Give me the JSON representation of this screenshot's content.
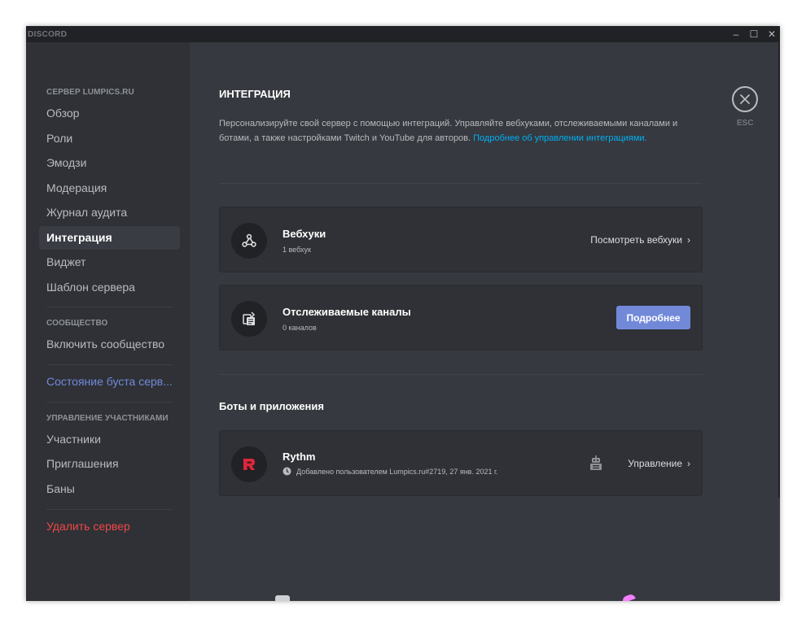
{
  "app": {
    "brand": "DISCORD"
  },
  "window_controls": {
    "minimize": "–",
    "maximize": "☐",
    "close": "✕"
  },
  "sidebar": {
    "group_server": "СЕРВЕР LUMPICS.RU",
    "items_server": [
      {
        "label": "Обзор"
      },
      {
        "label": "Роли"
      },
      {
        "label": "Эмодзи"
      },
      {
        "label": "Модерация"
      },
      {
        "label": "Журнал аудита"
      },
      {
        "label": "Интеграция"
      },
      {
        "label": "Виджет"
      },
      {
        "label": "Шаблон сервера"
      }
    ],
    "group_community": "СООБЩЕСТВО",
    "community_item": "Включить сообщество",
    "boost_item": "Состояние буста серв...",
    "group_members": "УПРАВЛЕНИЕ УЧАСТНИКАМИ",
    "items_members": [
      {
        "label": "Участники"
      },
      {
        "label": "Приглашения"
      },
      {
        "label": "Баны"
      }
    ],
    "delete_item": "Удалить сервер"
  },
  "main": {
    "title": "ИНТЕГРАЦИЯ",
    "description": "Персонализируйте свой сервер с помощью интеграций. Управляйте вебхуками, отслеживаемыми каналами и ботами, а также настройками Twitch и YouTube для авторов. ",
    "description_link": "Подробнее об управлении интеграциями.",
    "webhooks": {
      "title": "Вебхуки",
      "subtitle": "1 вебхук",
      "action": "Посмотреть вебхуки"
    },
    "followed": {
      "title": "Отслеживаемые каналы",
      "subtitle": "0 каналов",
      "button": "Подробнее"
    },
    "bots_section": "Боты и приложения",
    "bot": {
      "name": "Rythm",
      "added": "Добавлено пользователем Lumpics.ru#2719, 27 янв. 2021 г.",
      "action": "Управление"
    },
    "close_label": "ESC"
  },
  "colors": {
    "background": "#36393f",
    "sidebar": "#2f3136",
    "accent": "#7289da",
    "link": "#00aff4",
    "danger": "#f04747",
    "rythm_red": "#e0253b"
  },
  "icons": {
    "webhooks": "webhook-icon",
    "followed": "followed-channel-icon",
    "bot_avatar": "rythm-logo-icon",
    "added_by": "clock-icon",
    "bot_permissions": "robot-icon",
    "chevron": "chevron-right-icon",
    "close": "close-icon"
  }
}
